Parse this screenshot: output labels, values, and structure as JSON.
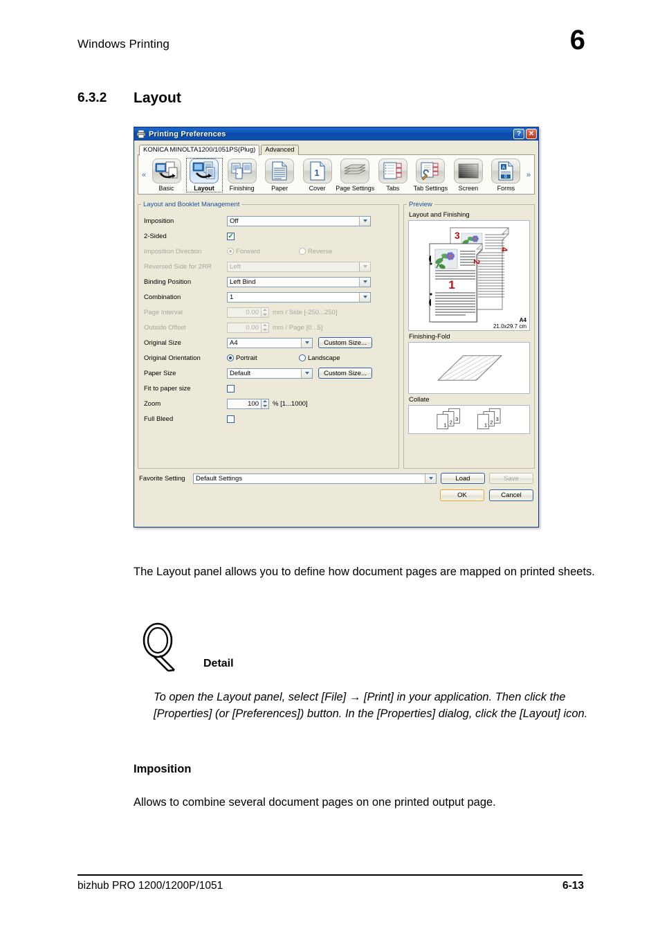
{
  "page": {
    "running_head": "Windows Printing",
    "chapter_number": "6",
    "section_number": "6.3.2",
    "section_title": "Layout",
    "intro_paragraph": "The Layout panel allows you to define how document pages are mapped on printed sheets.",
    "detail_label": "Detail",
    "detail_text": "To open the Layout panel, select [File] → [Print] in your application. Then click the [Properties] (or [Preferences]) button. In the [Properties] dialog, click the [Layout] icon.",
    "subsection_heading": "Imposition",
    "subsection_text": "Allows to combine several document pages on one printed output page.",
    "footer_left": "bizhub PRO 1200/1200P/1051",
    "footer_right": "6-13"
  },
  "dialog": {
    "title": "Printing Preferences",
    "titlebar_icon": "printer-icon",
    "help_button": "?",
    "close_button": "✕",
    "tabs": [
      {
        "label": "KONICA MINOLTA1200/1051PS(Plug)",
        "active": true
      },
      {
        "label": "Advanced",
        "active": false
      }
    ],
    "toolbar": {
      "scroll_left": "«",
      "scroll_right": "»",
      "items": [
        {
          "label": "Basic",
          "icon": "basic-icon",
          "selected": false
        },
        {
          "label": "Layout",
          "icon": "layout-icon",
          "selected": true
        },
        {
          "label": "Finishing",
          "icon": "finishing-icon",
          "selected": false
        },
        {
          "label": "Paper",
          "icon": "paper-icon",
          "selected": false
        },
        {
          "label": "Cover",
          "icon": "cover-icon",
          "selected": false
        },
        {
          "label": "Page Settings",
          "icon": "page-settings-icon",
          "selected": false
        },
        {
          "label": "Tabs",
          "icon": "tabs-icon",
          "selected": false
        },
        {
          "label": "Tab Settings",
          "icon": "tab-settings-icon",
          "selected": false
        },
        {
          "label": "Screen",
          "icon": "screen-icon",
          "selected": false
        },
        {
          "label": "Forms",
          "icon": "forms-icon",
          "selected": false
        }
      ]
    },
    "group": {
      "legend": "Layout and Booklet Management",
      "fields": {
        "imposition": {
          "label": "Imposition",
          "value": "Off",
          "type": "combo",
          "enabled": true
        },
        "two_sided": {
          "label": "2-Sided",
          "checked": true,
          "type": "checkbox",
          "enabled": true
        },
        "imposition_direction": {
          "label": "Imposition Direction",
          "type": "radio",
          "enabled": false,
          "options": [
            "Forward",
            "Reverse"
          ],
          "selected": "Forward"
        },
        "reversed_side_for_2rr": {
          "label": "Reversed Side for 2RR",
          "value": "Left",
          "type": "combo",
          "enabled": false
        },
        "binding_position": {
          "label": "Binding Position",
          "value": "Left Bind",
          "type": "combo",
          "enabled": true
        },
        "combination": {
          "label": "Combination",
          "value": "1",
          "type": "combo",
          "enabled": true
        },
        "page_interval": {
          "label": "Page Interval",
          "value": "0.00",
          "unit": "mm / Side [-250...250]",
          "type": "spinner",
          "enabled": false
        },
        "outside_offset": {
          "label": "Outside Offset",
          "value": "0.00",
          "unit": "mm / Page [0...5]",
          "type": "spinner",
          "enabled": false
        },
        "original_size": {
          "label": "Original Size",
          "value": "A4",
          "type": "combo",
          "enabled": true,
          "button": "Custom Size..."
        },
        "original_orientation": {
          "label": "Original Orientation",
          "type": "radio",
          "enabled": true,
          "options": [
            "Portrait",
            "Landscape"
          ],
          "selected": "Portrait"
        },
        "paper_size": {
          "label": "Paper Size",
          "value": "Default",
          "type": "combo",
          "enabled": true,
          "button": "Custom Size..."
        },
        "fit_to_paper_size": {
          "label": "Fit to paper size",
          "checked": false,
          "type": "checkbox",
          "enabled": true
        },
        "zoom": {
          "label": "Zoom",
          "value": "100",
          "unit": "% [1...1000]",
          "type": "spinner",
          "enabled": true
        },
        "full_bleed": {
          "label": "Full Bleed",
          "checked": false,
          "type": "checkbox",
          "enabled": true
        }
      }
    },
    "preview": {
      "legend": "Preview",
      "layout_caption": "Layout and Finishing",
      "paper_name": "A4",
      "paper_dimensions": "21.0x29.7 cm",
      "page_numbers": [
        "1",
        "2",
        "3",
        "4"
      ],
      "fold_caption": "Finishing-Fold",
      "collate_caption": "Collate",
      "collate_page_numbers": [
        "1",
        "2",
        "3"
      ]
    },
    "footer": {
      "favorite_label": "Favorite Setting",
      "favorite_value": "Default Settings",
      "load_button": "Load",
      "save_button": "Save",
      "ok_button": "OK",
      "cancel_button": "Cancel"
    }
  },
  "colors": {
    "titlebar": "#0a4ca8",
    "dialog_face": "#ece9d8",
    "legend_text": "#1b4f9c",
    "default_button_border": "#e8a33d",
    "preview_number": "#c01010"
  }
}
